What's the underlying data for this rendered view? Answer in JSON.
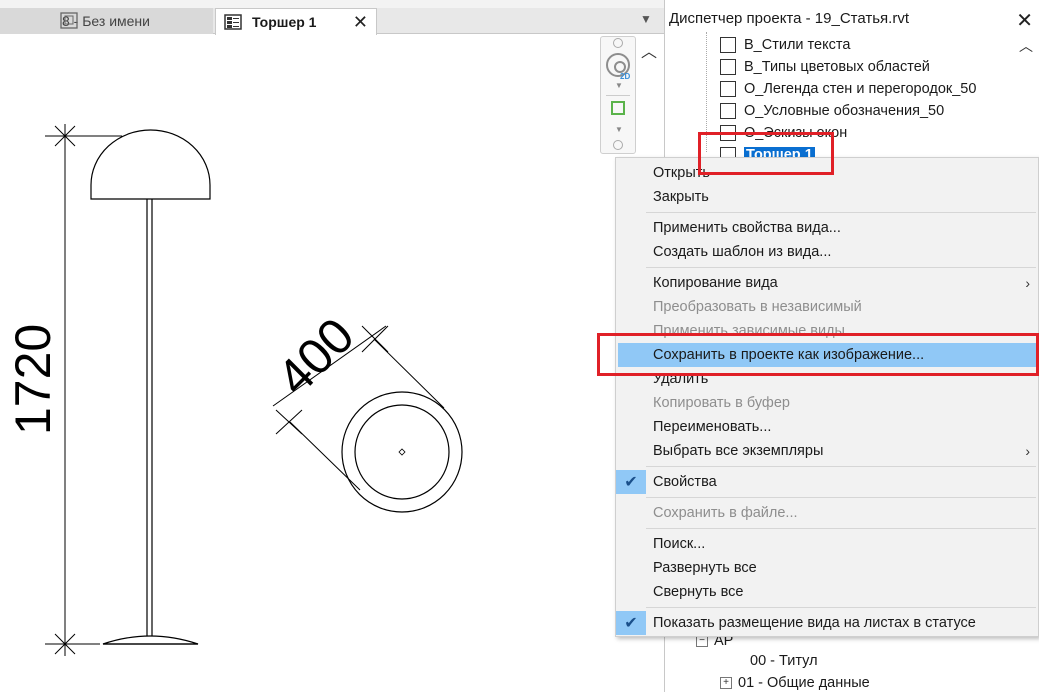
{
  "tabs": [
    {
      "label": "8 - Без имени",
      "active": false
    },
    {
      "label": "Торшер 1",
      "active": true
    }
  ],
  "drawing": {
    "dim_height": "1720",
    "dim_diameter": "400"
  },
  "browser": {
    "title": "Диспетчер проекта - 19_Статья.rvt",
    "items": [
      "В_Стили текста",
      "В_Типы цветовых областей",
      "О_Легенда стен и перегородок_50",
      "О_Условные обозначения_50",
      "О_Эскизы окон",
      "Торшер 1"
    ],
    "bottom": {
      "group": "АР",
      "sheet1": "00 - Титул",
      "sheet2": "01 - Общие данные"
    }
  },
  "menu": {
    "items": [
      {
        "label": "Открыть"
      },
      {
        "label": "Закрыть"
      },
      {
        "label": "Применить свойства вида..."
      },
      {
        "label": "Создать шаблон из вида..."
      },
      {
        "label": "Копирование вида"
      },
      {
        "label": "Преобразовать в независимый"
      },
      {
        "label": "Применить зависимые виды..."
      },
      {
        "label": "Сохранить в проекте как изображение..."
      },
      {
        "label": "Удалить"
      },
      {
        "label": "Копировать в буфер"
      },
      {
        "label": "Переименовать..."
      },
      {
        "label": "Выбрать все экземпляры"
      },
      {
        "label": "Свойства"
      },
      {
        "label": "Сохранить в файле..."
      },
      {
        "label": "Поиск..."
      },
      {
        "label": "Развернуть все"
      },
      {
        "label": "Свернуть все"
      },
      {
        "label": "Показать размещение вида на листах в статусе"
      }
    ]
  },
  "colors": {
    "highlight": "#90c8f6",
    "selection": "#0a6fd1",
    "annotation_red": "#e02027"
  }
}
